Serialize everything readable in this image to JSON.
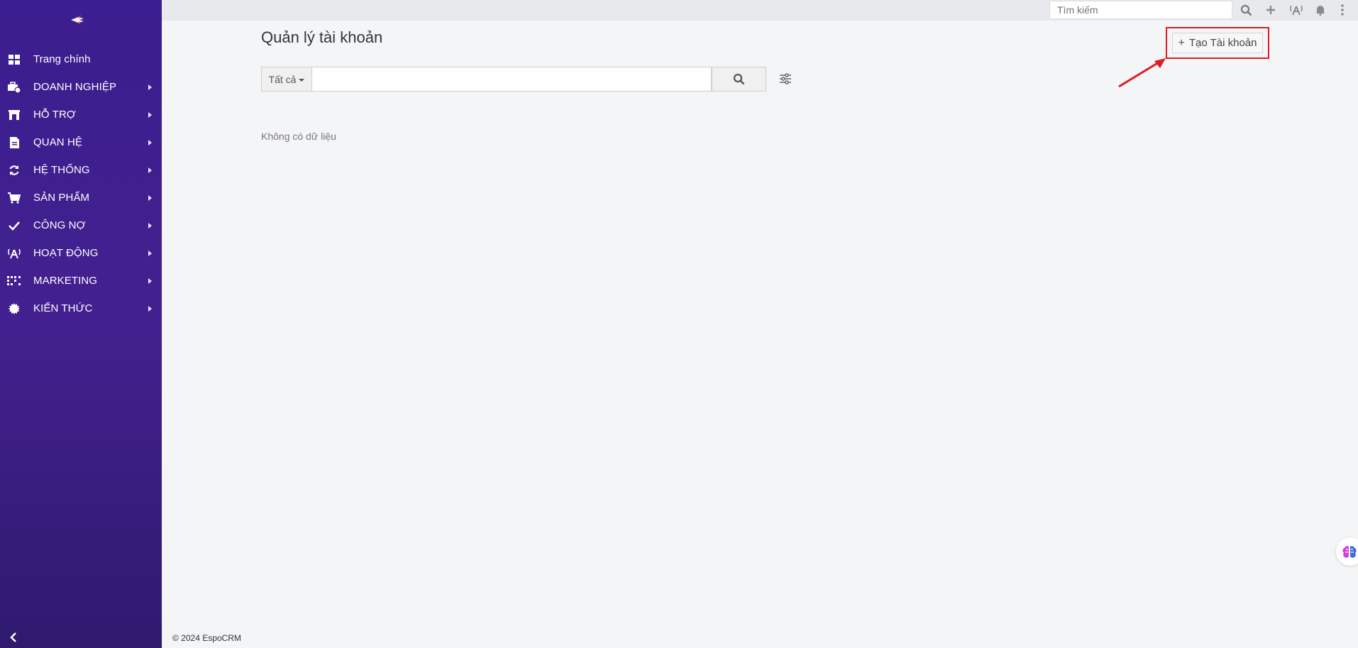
{
  "sidebar": {
    "items": [
      {
        "label": "Trang chính",
        "icon": "dashboard-icon",
        "has_submenu": false
      },
      {
        "label": "DOANH NGHIỆP",
        "icon": "business-icon",
        "has_submenu": true
      },
      {
        "label": "HỖ TRỢ",
        "icon": "support-icon",
        "has_submenu": true
      },
      {
        "label": "QUAN HỆ",
        "icon": "document-icon",
        "has_submenu": true
      },
      {
        "label": "HỆ THỐNG",
        "icon": "sync-icon",
        "has_submenu": true
      },
      {
        "label": "SẢN PHẨM",
        "icon": "cart-icon",
        "has_submenu": true
      },
      {
        "label": "CÔNG NỢ",
        "icon": "check-icon",
        "has_submenu": true
      },
      {
        "label": "HOẠT ĐỘNG",
        "icon": "broadcast-icon",
        "has_submenu": true
      },
      {
        "label": "MARKETING",
        "icon": "grid-dots-icon",
        "has_submenu": true
      },
      {
        "label": "KIẾN THỨC",
        "icon": "badge-icon",
        "has_submenu": true
      }
    ]
  },
  "topbar": {
    "search_placeholder": "Tìm kiếm"
  },
  "main": {
    "title": "Quản lý tài khoản",
    "create_button_label": "Tạo Tài khoản",
    "filter_label": "Tất cả",
    "search_value": "",
    "empty_text": "Không có dữ liệu"
  },
  "footer": {
    "text": "© 2024 EspoCRM"
  },
  "colors": {
    "sidebar_top": "#3b1e8f",
    "sidebar_bottom": "#2f1a6e",
    "highlight": "#e01b24"
  }
}
